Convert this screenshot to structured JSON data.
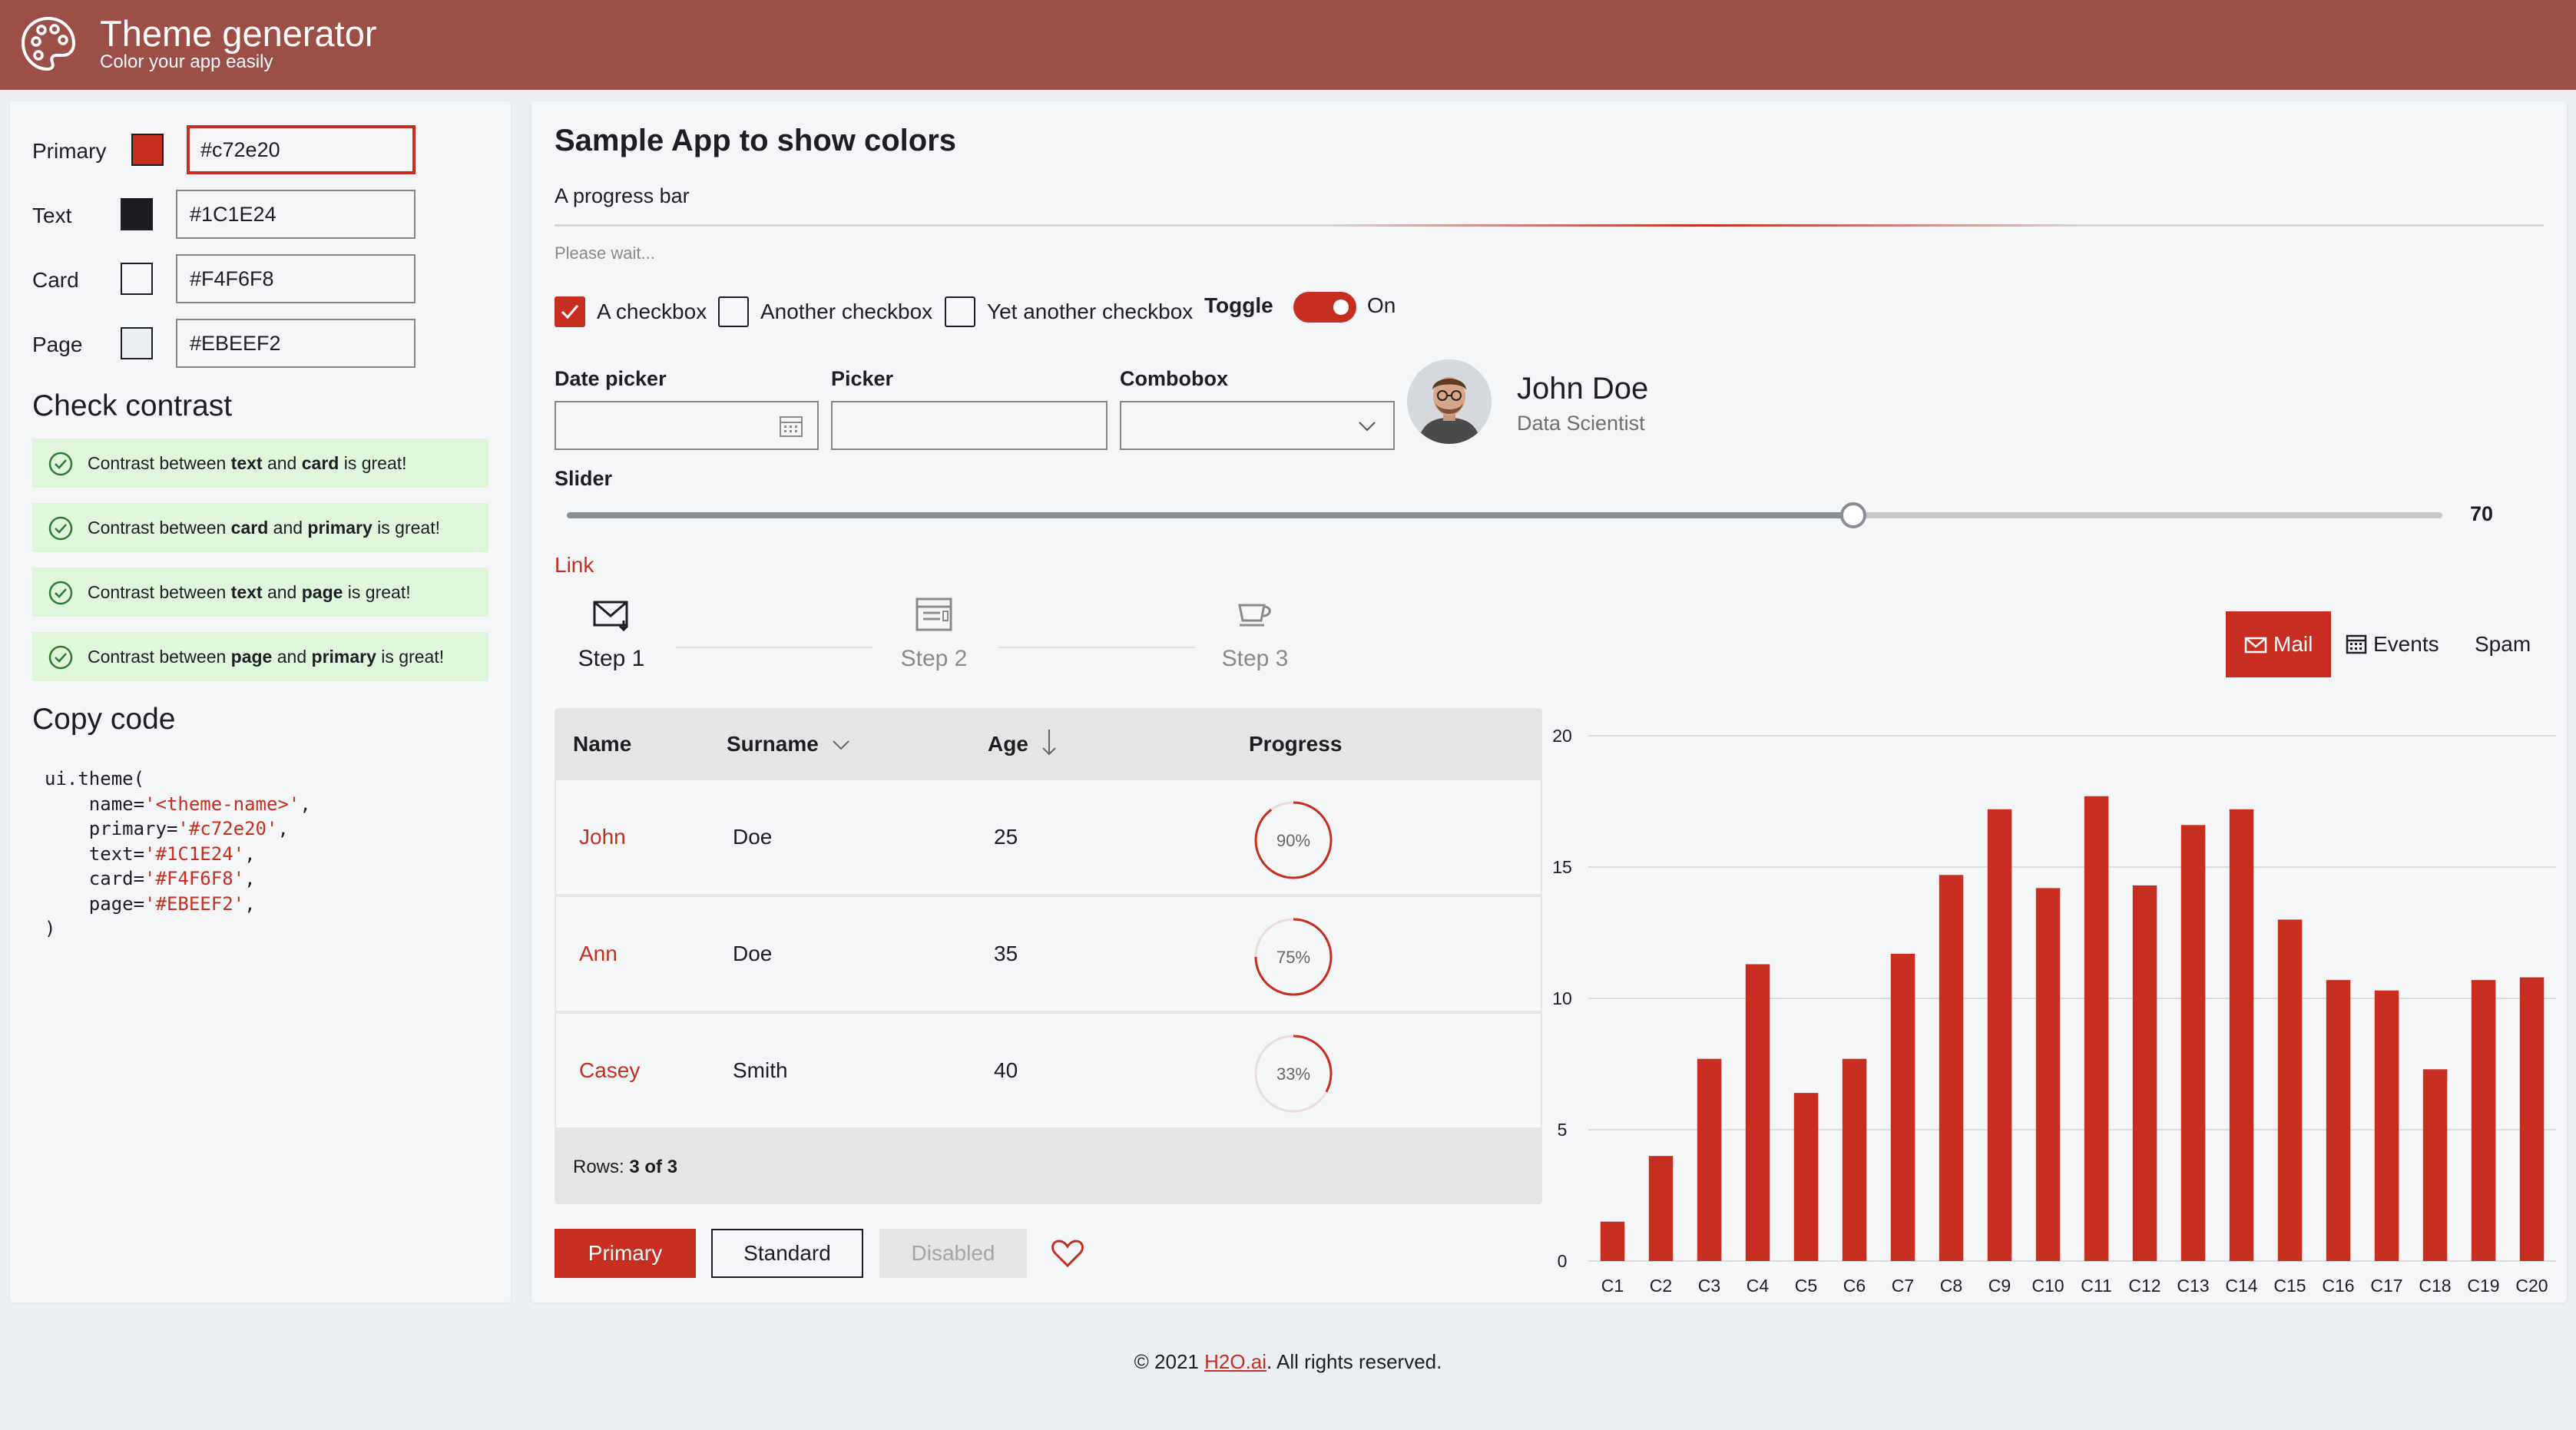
{
  "header": {
    "title": "Theme generator",
    "subtitle": "Color your app easily"
  },
  "colors": {
    "primary": {
      "label": "Primary",
      "value": "#c72e20",
      "swatch": "#c72e20"
    },
    "text": {
      "label": "Text",
      "value": "#1C1E24",
      "swatch": "#1C1E24"
    },
    "card": {
      "label": "Card",
      "value": "#F4F6F8",
      "swatch": "#F4F6F8"
    },
    "page": {
      "label": "Page",
      "value": "#EBEEF2",
      "swatch": "#EBEEF2"
    }
  },
  "contrast": {
    "title": "Check contrast",
    "checks": [
      {
        "pre": "Contrast between ",
        "a": "text",
        "mid": " and ",
        "b": "card",
        "post": " is great!"
      },
      {
        "pre": "Contrast between ",
        "a": "card",
        "mid": " and ",
        "b": "primary",
        "post": " is great!"
      },
      {
        "pre": "Contrast between ",
        "a": "text",
        "mid": " and ",
        "b": "page",
        "post": " is great!"
      },
      {
        "pre": "Contrast between ",
        "a": "page",
        "mid": " and ",
        "b": "primary",
        "post": " is great!"
      }
    ]
  },
  "copy_code": {
    "title": "Copy code",
    "open": "ui.theme(",
    "lines": [
      {
        "key": "    name=",
        "val": "'<theme-name>'"
      },
      {
        "key": "    primary=",
        "val": "'#c72e20'"
      },
      {
        "key": "    text=",
        "val": "'#1C1E24'"
      },
      {
        "key": "    card=",
        "val": "'#F4F6F8'"
      },
      {
        "key": "    page=",
        "val": "'#EBEEF2'"
      }
    ],
    "close": ")"
  },
  "sample": {
    "title": "Sample App to show colors",
    "progress_label": "A progress bar",
    "progress_caption": "Please wait...",
    "checkboxes": [
      {
        "label": "A checkbox",
        "checked": true
      },
      {
        "label": "Another checkbox",
        "checked": false
      },
      {
        "label": "Yet another checkbox",
        "checked": false
      }
    ],
    "toggle": {
      "label": "Toggle",
      "state": "On",
      "on": true
    },
    "date_picker_label": "Date picker",
    "picker_label": "Picker",
    "combobox_label": "Combobox",
    "person": {
      "name": "John Doe",
      "role": "Data Scientist"
    },
    "slider": {
      "label": "Slider",
      "value": 70,
      "min": 0,
      "max": 100
    },
    "link": "Link",
    "steps": [
      {
        "label": "Step 1",
        "icon": "mail-icon",
        "active": true
      },
      {
        "label": "Step 2",
        "icon": "calendar-icon",
        "active": false
      },
      {
        "label": "Step 3",
        "icon": "coffee-icon",
        "active": false
      }
    ],
    "tabs": [
      {
        "label": "Mail",
        "icon": "mail-icon",
        "active": true
      },
      {
        "label": "Events",
        "icon": "calendar-icon",
        "active": false
      },
      {
        "label": "Spam",
        "icon": "",
        "active": false
      }
    ],
    "table": {
      "columns": [
        "Name",
        "Surname",
        "Age",
        "Progress"
      ],
      "rows": [
        {
          "name": "John",
          "surname": "Doe",
          "age": "25",
          "progress": 0.9,
          "progress_label": "90%"
        },
        {
          "name": "Ann",
          "surname": "Doe",
          "age": "35",
          "progress": 0.75,
          "progress_label": "75%"
        },
        {
          "name": "Casey",
          "surname": "Smith",
          "age": "40",
          "progress": 0.33,
          "progress_label": "33%"
        }
      ],
      "footer_label": "Rows:",
      "footer_value": "3 of 3"
    },
    "buttons": {
      "primary": "Primary",
      "standard": "Standard",
      "disabled": "Disabled"
    }
  },
  "chart_data": {
    "type": "bar",
    "categories": [
      "C1",
      "C2",
      "C3",
      "C4",
      "C5",
      "C6",
      "C7",
      "C8",
      "C9",
      "C10",
      "C11",
      "C12",
      "C13",
      "C14",
      "C15",
      "C16",
      "C17",
      "C18",
      "C19",
      "C20"
    ],
    "values": [
      1.5,
      4,
      7.7,
      11.3,
      6.4,
      7.7,
      11.7,
      14.7,
      17.2,
      14.2,
      17.7,
      14.3,
      16.6,
      17.2,
      13,
      10.7,
      10.3,
      7.3,
      10.7,
      10.8
    ],
    "yticks": [
      0,
      5,
      10,
      15,
      20
    ],
    "ylim": [
      0,
      20
    ],
    "grid": true,
    "color": "#c72e20"
  },
  "footer": {
    "prefix": "© 2021 ",
    "link": "H2O.ai",
    "suffix": ". All rights reserved."
  }
}
